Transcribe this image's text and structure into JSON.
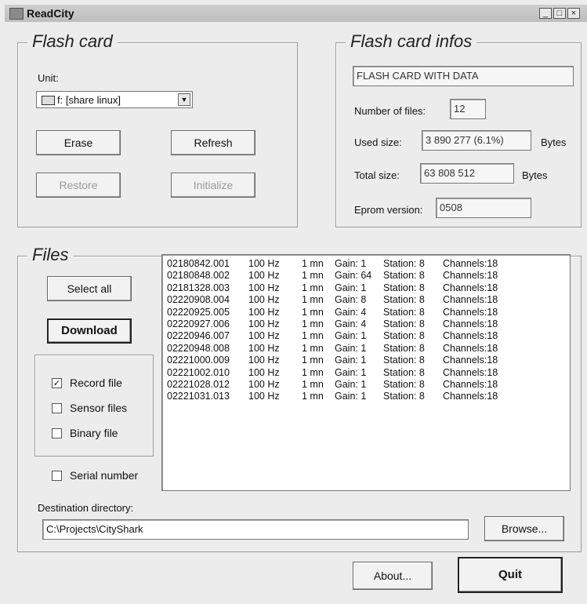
{
  "window": {
    "title": "ReadCity",
    "minimize": "_",
    "maximize": "□",
    "close": "×"
  },
  "flash_card": {
    "legend": "Flash card",
    "unit_label": "Unit:",
    "unit_value": "f: [share linux]",
    "erase_label": "Erase",
    "refresh_label": "Refresh",
    "restore_label": "Restore",
    "initialize_label": "Initialize"
  },
  "infos": {
    "legend": "Flash card infos",
    "status": "FLASH CARD WITH DATA",
    "num_files_label": "Number of files:",
    "num_files_value": "12",
    "used_label": "Used size:",
    "used_value": "3 890 277 (6.1%)",
    "used_unit": "Bytes",
    "total_label": "Total size:",
    "total_value": "63 808 512",
    "total_unit": "Bytes",
    "eprom_label": "Eprom version:",
    "eprom_value": "0508"
  },
  "files": {
    "legend": "Files",
    "select_all_label": "Select all",
    "download_label": "Download",
    "record_file_label": "Record file",
    "record_file_checked": true,
    "sensor_files_label": "Sensor files",
    "sensor_files_checked": false,
    "binary_file_label": "Binary file",
    "binary_file_checked": false,
    "serial_number_label": "Serial number",
    "serial_number_checked": false,
    "check_mark": "✓",
    "rows": [
      {
        "name": "02180842.001",
        "freq": "100 Hz",
        "dur": "1 mn",
        "gain": "Gain:  1",
        "station": "Station:  8",
        "channels": "Channels:18"
      },
      {
        "name": "02180848.002",
        "freq": "100 Hz",
        "dur": "1 mn",
        "gain": "Gain: 64",
        "station": "Station:  8",
        "channels": "Channels:18"
      },
      {
        "name": "02181328.003",
        "freq": "100 Hz",
        "dur": "1 mn",
        "gain": "Gain:  1",
        "station": "Station:  8",
        "channels": "Channels:18"
      },
      {
        "name": "02220908.004",
        "freq": "100 Hz",
        "dur": "1 mn",
        "gain": "Gain:  8",
        "station": "Station:  8",
        "channels": "Channels:18"
      },
      {
        "name": "02220925.005",
        "freq": "100 Hz",
        "dur": "1 mn",
        "gain": "Gain:  4",
        "station": "Station:  8",
        "channels": "Channels:18"
      },
      {
        "name": "02220927.006",
        "freq": "100 Hz",
        "dur": "1 mn",
        "gain": "Gain:  4",
        "station": "Station:  8",
        "channels": "Channels:18"
      },
      {
        "name": "02220946.007",
        "freq": "100 Hz",
        "dur": "1 mn",
        "gain": "Gain:  1",
        "station": "Station:  8",
        "channels": "Channels:18"
      },
      {
        "name": "02220948.008",
        "freq": "100 Hz",
        "dur": "1 mn",
        "gain": "Gain:  1",
        "station": "Station:  8",
        "channels": "Channels:18"
      },
      {
        "name": "02221000.009",
        "freq": "100 Hz",
        "dur": "1 mn",
        "gain": "Gain:  1",
        "station": "Station:  8",
        "channels": "Channels:18"
      },
      {
        "name": "02221002.010",
        "freq": "100 Hz",
        "dur": "1 mn",
        "gain": "Gain:  1",
        "station": "Station:  8",
        "channels": "Channels:18"
      },
      {
        "name": "02221028.012",
        "freq": "100 Hz",
        "dur": "1 mn",
        "gain": "Gain:  1",
        "station": "Station:  8",
        "channels": "Channels:18"
      },
      {
        "name": "02221031.013",
        "freq": "100 Hz",
        "dur": "1 mn",
        "gain": "Gain:  1",
        "station": "Station:  8",
        "channels": "Channels:18"
      }
    ]
  },
  "destination": {
    "label": "Destination directory:",
    "value": "C:\\Projects\\CityShark",
    "browse_label": "Browse..."
  },
  "footer": {
    "about_label": "About...",
    "quit_label": "Quit"
  }
}
